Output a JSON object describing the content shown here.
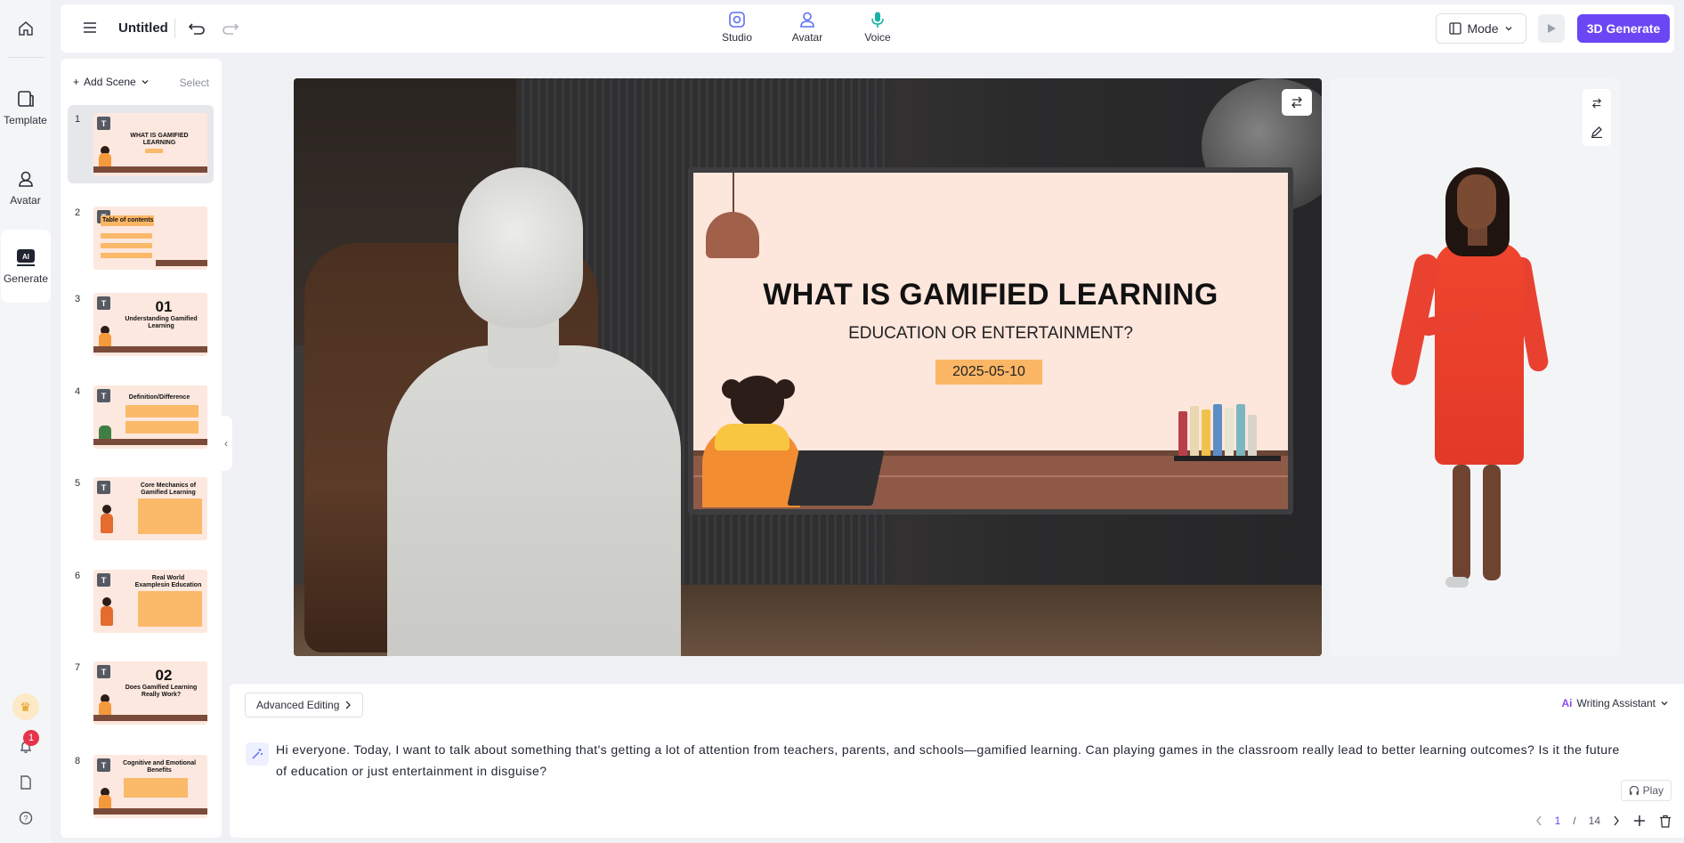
{
  "rail": {
    "items": [
      {
        "label": "Template",
        "icon": "template-icon"
      },
      {
        "label": "Avatar",
        "icon": "avatar-icon"
      },
      {
        "label": "Generate",
        "icon": "ai-generate-icon"
      }
    ],
    "notification_count": "1"
  },
  "topbar": {
    "title": "Untitled",
    "tabs": [
      {
        "label": "Studio",
        "icon": "studio-icon"
      },
      {
        "label": "Avatar",
        "icon": "avatar-icon"
      },
      {
        "label": "Voice",
        "icon": "microphone-icon"
      }
    ],
    "mode_label": "Mode",
    "generate_label": "3D Generate"
  },
  "scenes": {
    "add_label": "Add Scene",
    "select_label": "Select",
    "items": [
      {
        "num": "1",
        "title": "WHAT IS GAMIFIED LEARNING"
      },
      {
        "num": "2",
        "title": "Table of contents"
      },
      {
        "num": "3",
        "title": "01",
        "subtitle": "Understanding Gamified Learning"
      },
      {
        "num": "4",
        "title": "Definition/Difference"
      },
      {
        "num": "5",
        "title": "Core Mechanics of Gamified Learning"
      },
      {
        "num": "6",
        "title": "Real World Examplesin Education"
      },
      {
        "num": "7",
        "title": "02",
        "subtitle": "Does Gamified Learning Really Work?"
      },
      {
        "num": "8",
        "title": "Cognitive and Emotional Benefits"
      }
    ]
  },
  "slide": {
    "title": "WHAT IS GAMIFIED LEARNING",
    "subtitle": "EDUCATION OR ENTERTAINMENT?",
    "date": "2025-05-10"
  },
  "editor": {
    "advanced_label": "Advanced Editing",
    "writing_assistant_label": "Writing Assistant",
    "script": "Hi everyone. Today, I want to talk about something that's getting a lot of attention from teachers, parents, and schools—gamified learning. Can playing games in the classroom really lead to better learning outcomes? Is it the future of education or just entertainment in disguise?",
    "play_label": "Play",
    "page_current": "1",
    "page_sep": "/",
    "page_total": "14"
  },
  "colors": {
    "accent": "#6b46f5",
    "slide_bg": "#fde6dc",
    "date_box": "#fbb665",
    "dress": "#f0452e"
  }
}
